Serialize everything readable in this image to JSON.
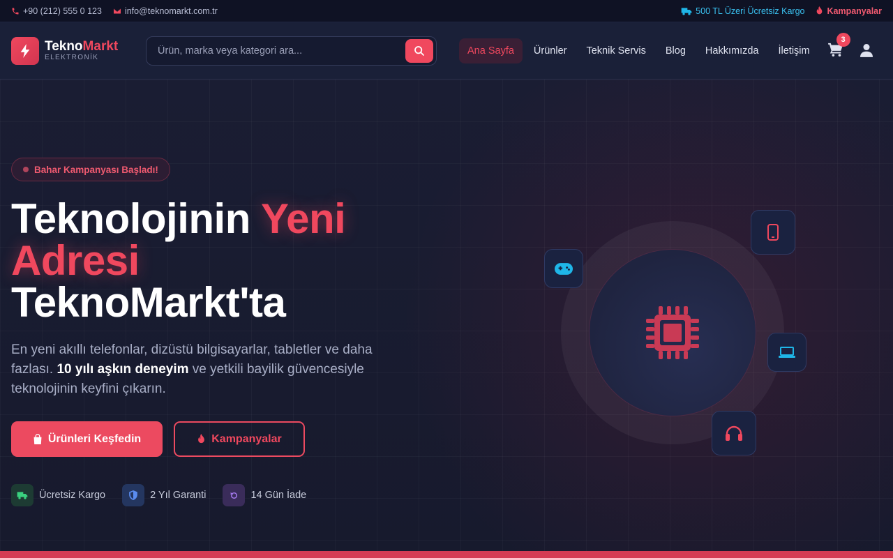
{
  "topbar": {
    "phone": "+90 (212) 555 0 123",
    "email": "info@teknomarkt.com.tr",
    "shipping": "500 TL Üzeri Ücretsiz Kargo",
    "campaigns": "Kampanyalar"
  },
  "header": {
    "logo_main": "Tekno",
    "logo_accent": "Markt",
    "logo_sub": "ELEKTRONİK",
    "search_placeholder": "Ürün, marka veya kategori ara...",
    "nav": [
      "Ana Sayfa",
      "Ürünler",
      "Teknik Servis",
      "Blog",
      "Hakkımızda",
      "İletişim"
    ],
    "cart_count": "3"
  },
  "hero": {
    "badge": "Bahar Kampanyası Başladı!",
    "title_part1": "Teknolojinin ",
    "title_accent": "Yeni Adresi",
    "title_part2": "TeknoMarkt'ta",
    "subtitle_a": "En yeni akıllı telefonlar, dizüstü bilgisayarlar, tabletler ve daha fazlası. ",
    "subtitle_bold": "10 yılı aşkın deneyim",
    "subtitle_b": " ve yetkili bayilik güvencesiyle teknolojinin keyfini çıkarın.",
    "btn_primary": "Ürünleri Keşfedin",
    "btn_secondary": "Kampanyalar",
    "features": [
      "Ücretsiz Kargo",
      "2 Yıl Garanti",
      "14 Gün İade"
    ]
  },
  "colors": {
    "accent": "#f0485e",
    "cyan": "#1fb6e8",
    "background": "#161a2e"
  }
}
